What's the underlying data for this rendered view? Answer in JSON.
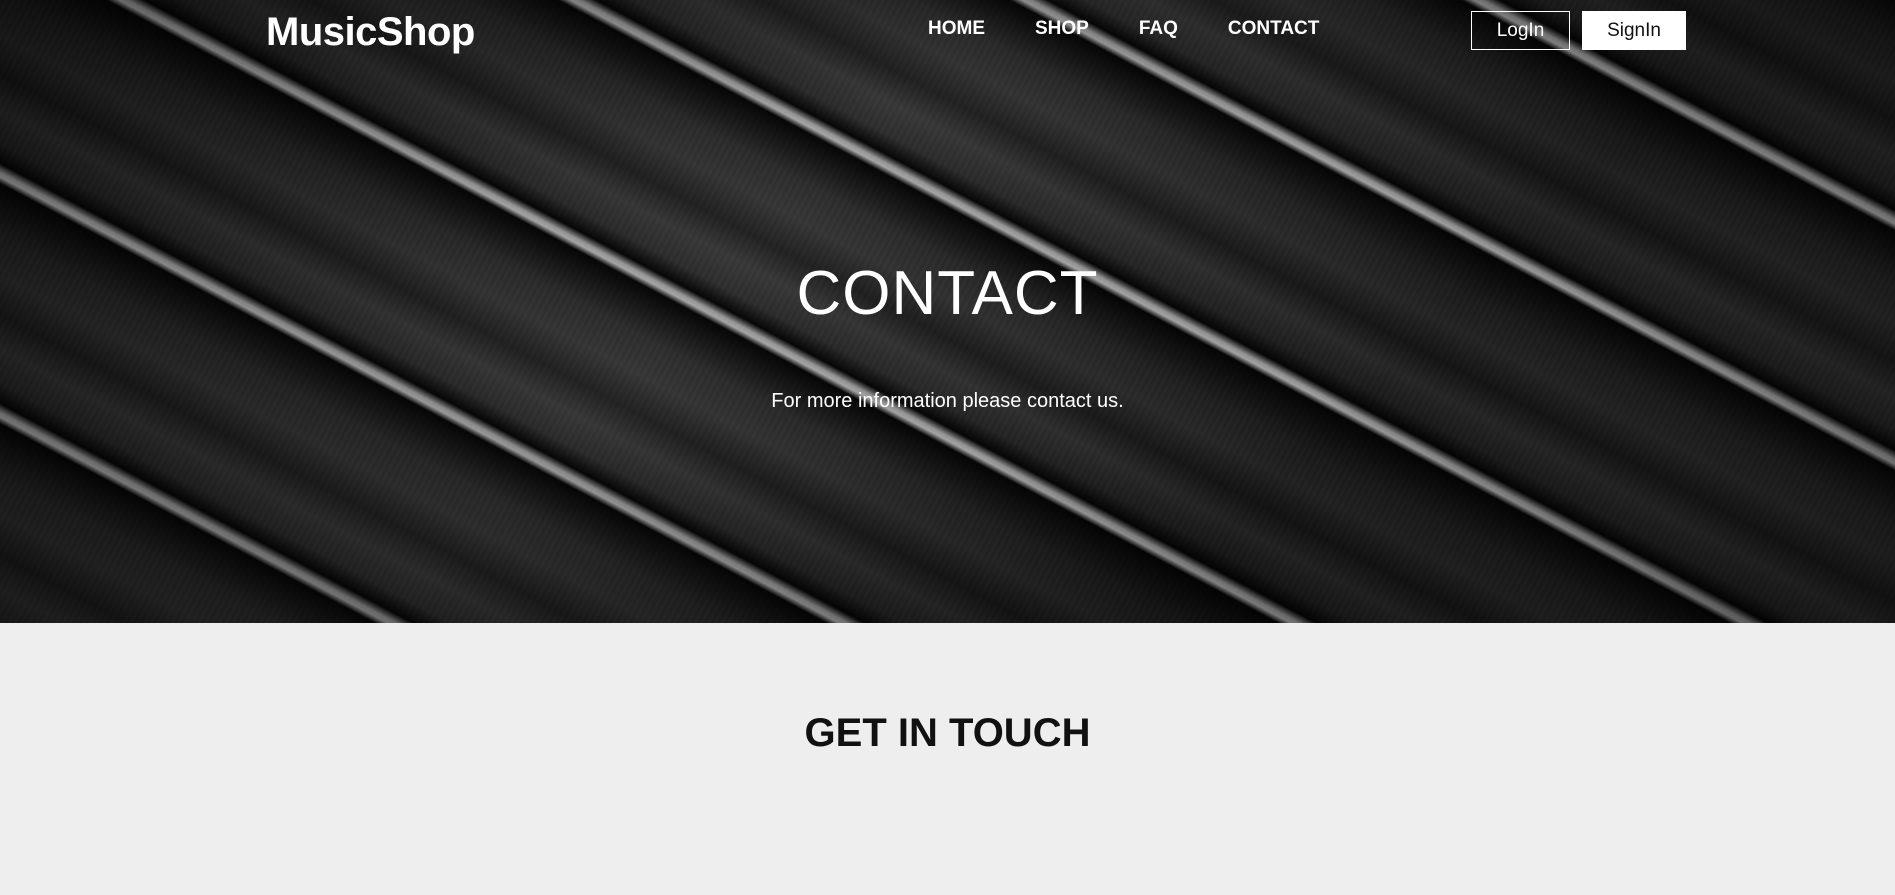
{
  "header": {
    "brand": "MusicShop",
    "nav": [
      {
        "label": "HOME"
      },
      {
        "label": "SHOP"
      },
      {
        "label": "FAQ"
      },
      {
        "label": "CONTACT"
      }
    ],
    "login_label": "LogIn",
    "signin_label": "SignIn"
  },
  "hero": {
    "title": "CONTACT",
    "subtitle": "For more information please contact us."
  },
  "section": {
    "title": "GET IN TOUCH"
  },
  "colors": {
    "section_background": "#eeeeee",
    "hero_text": "#ffffff",
    "heading_text": "#111111"
  }
}
